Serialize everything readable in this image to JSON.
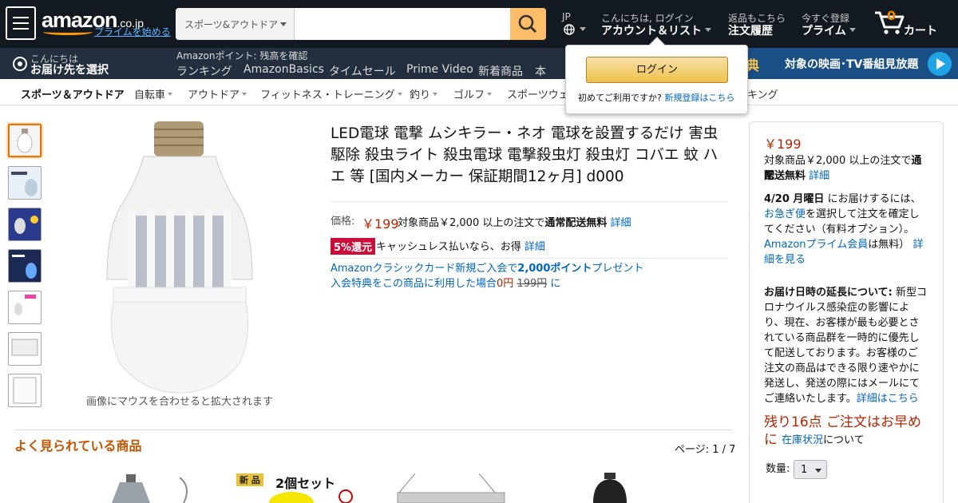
{
  "header": {
    "logo_text": "amazon",
    "logo_suffix": ".co.jp",
    "prime_start": "プライムを始める",
    "search_category": "スポーツ&アウトドア",
    "search_placeholder": "",
    "lang": "JP",
    "account_greeting": "こんにちは, ログイン",
    "account_label": "アカウント＆リスト",
    "orders_small": "返品もこちら",
    "orders_big": "注文履歴",
    "prime_small": "今すぐ登録",
    "prime_big": "プライム",
    "cart_count": "0",
    "cart_label": "カート"
  },
  "subbar": {
    "deliver_small": "こんにちは",
    "deliver_big": "お届け先を選択",
    "points": "Amazonポイント: 残高を確認",
    "items": [
      "ランキング",
      "AmazonBasics",
      "タイムセール",
      "Prime Video",
      "新着商品",
      "本"
    ],
    "banner_tag": "典",
    "banner_text": "対象の映画･TV番組見放題"
  },
  "popover": {
    "login_button": "ログイン",
    "first_time": "初めてご利用ですか?",
    "signup": "新規登録はこちら"
  },
  "categories": [
    "スポーツ＆アウトドア",
    "自転車",
    "アウトドア",
    "フィットネス・トレーニング",
    "釣り",
    "ゴルフ",
    "スポーツウェ",
    "キング"
  ],
  "product": {
    "title": "LED電球 電撃 ムシキラー・ネオ 電球を設置するだけ 害虫駆除 殺虫ライト 殺虫電球 電撃殺虫灯 殺虫灯 コバエ 蚊 ハエ 等 [国内メーカー 保証期間12ヶ月] d000",
    "price_label": "価格:",
    "price": "￥199",
    "shipping_pre": "対象商品￥2,000 以上の注文で",
    "shipping_bold": "通常配送無料",
    "details": "詳細",
    "cashback_badge": "5%還元",
    "cashback_text": "キャッシュレス払いなら、お得",
    "card_line1_a": "Amazonクラシックカード新規ご入会で",
    "card_line1_b": "2,000ポイント",
    "card_line1_c": "プレゼント",
    "card_line2_a": "入会特典をこの商品に利用した場合",
    "card_line2_b": "0円",
    "card_line2_c": "199円",
    "card_line2_d": "に",
    "zoom_hint": "画像にマウスを合わせると拡大されます"
  },
  "related": {
    "title": "よく見られている商品",
    "page": "ページ: 1 / 7",
    "item2_badge": "新 品",
    "item2_text": "2個セット"
  },
  "buybox": {
    "price": "￥199",
    "ship_pre": "対象商品￥2,000 以上の注文で",
    "ship_bold1": "通常",
    "ship_bold2": "配送無料",
    "details": "詳細",
    "date": "4/20 月曜日",
    "date_post": "にお届けするには、",
    "rush": "お急ぎ便",
    "rush_post": "を選択して注文を確定してください（有料オプション）。",
    "prime_member": "Amazonプライム会員",
    "prime_free": "は無料）",
    "prime_details": "詳細を見る",
    "delay_head": "お届け日時の延長について:",
    "delay_text": "新型コロナウイルス感染症の影響により、現在、お客様が最も必要とされている商品群を一時的に優先して配送しております。お客様のご注文の商品はできる限り速やかに発送し、発送の際にはメールにてご連絡いたします。",
    "delay_link": "詳細はこちら",
    "stock": "残り16点 ご注文はお早めに",
    "stock_link": "在庫状況",
    "stock_post": "について",
    "qty_label": "数量:",
    "qty_value": "1"
  }
}
